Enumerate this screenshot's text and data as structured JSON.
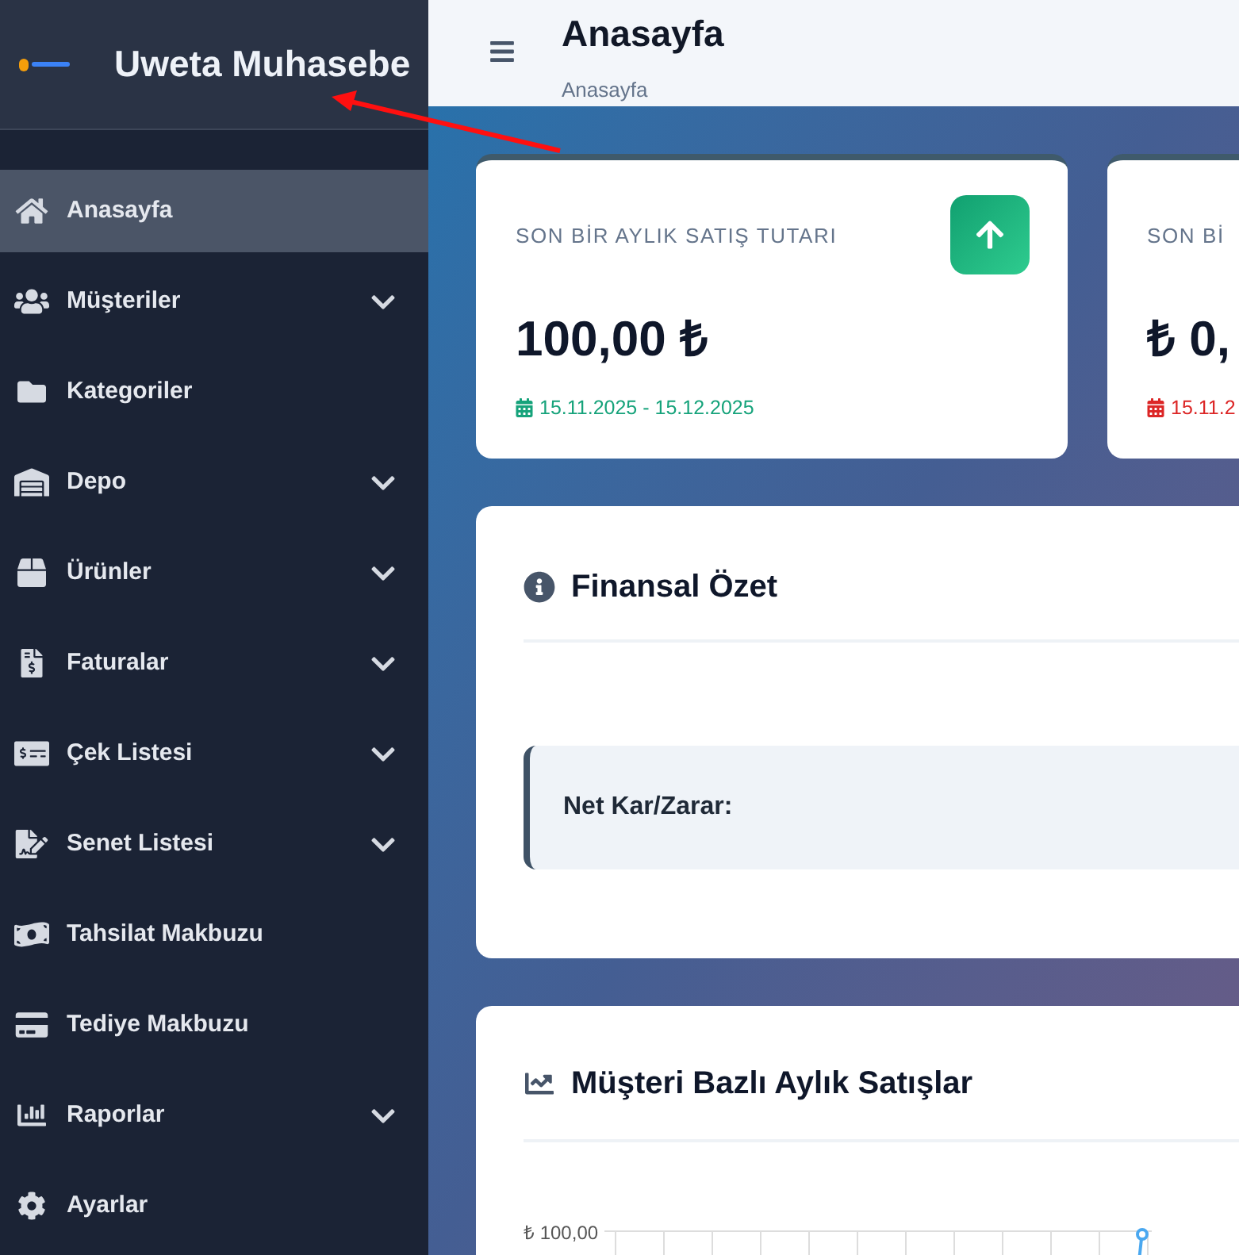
{
  "sidebar": {
    "brand": "Uweta Muhasebe",
    "items": [
      {
        "label": "Anasayfa",
        "selected": true,
        "has_submenu": false
      },
      {
        "label": "Müşteriler",
        "selected": false,
        "has_submenu": true
      },
      {
        "label": "Kategoriler",
        "selected": false,
        "has_submenu": false
      },
      {
        "label": "Depo",
        "selected": false,
        "has_submenu": true
      },
      {
        "label": "Ürünler",
        "selected": false,
        "has_submenu": true
      },
      {
        "label": "Faturalar",
        "selected": false,
        "has_submenu": true
      },
      {
        "label": "Çek Listesi",
        "selected": false,
        "has_submenu": true
      },
      {
        "label": "Senet Listesi",
        "selected": false,
        "has_submenu": true
      },
      {
        "label": "Tahsilat Makbuzu",
        "selected": false,
        "has_submenu": false
      },
      {
        "label": "Tediye Makbuzu",
        "selected": false,
        "has_submenu": false
      },
      {
        "label": "Raporlar",
        "selected": false,
        "has_submenu": true
      },
      {
        "label": "Ayarlar",
        "selected": false,
        "has_submenu": false
      }
    ]
  },
  "header": {
    "title": "Anasayfa",
    "breadcrumb": "Anasayfa"
  },
  "stat_cards": [
    {
      "title": "SON BİR AYLIK SATIŞ TUTARI",
      "value": "100,00 ₺",
      "date_range": "15.11.2025 - 15.12.2025",
      "color": "#16a37b"
    },
    {
      "title": "SON Bİ",
      "value": "₺ 0,",
      "date_range": "15.11.2",
      "color": "#dc2626"
    }
  ],
  "financial_summary": {
    "title": "Finansal Özet",
    "net_label": "Net Kar/Zarar:"
  },
  "sales_chart": {
    "title": "Müşteri Bazlı Aylık Satışlar",
    "y_tick": "₺ 100,00"
  }
}
